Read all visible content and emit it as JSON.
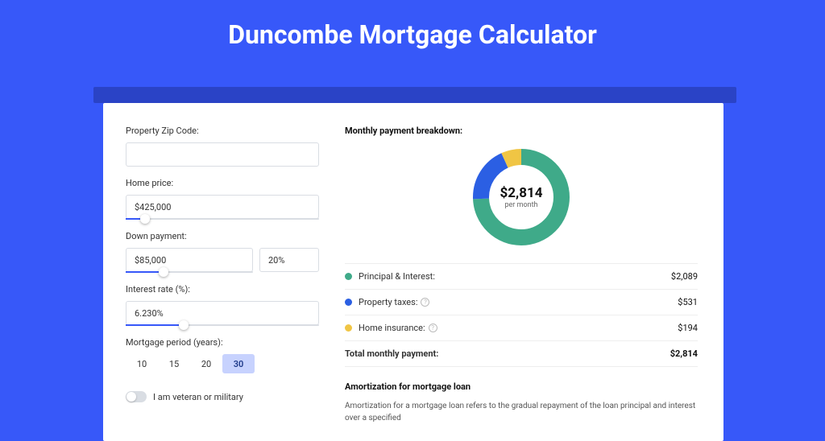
{
  "header": {
    "title": "Duncombe Mortgage Calculator"
  },
  "form": {
    "zip": {
      "label": "Property Zip Code:",
      "value": ""
    },
    "home_price": {
      "label": "Home price:",
      "value": "$425,000",
      "slider_pct": 10
    },
    "down": {
      "label": "Down payment:",
      "value": "$85,000",
      "pct": "20%",
      "slider_pct": 20
    },
    "rate": {
      "label": "Interest rate (%):",
      "value": "6.230%",
      "slider_pct": 30
    },
    "period": {
      "label": "Mortgage period (years):",
      "options": [
        "10",
        "15",
        "20",
        "30"
      ],
      "active": "30"
    },
    "veteran": {
      "label": "I am veteran or military"
    }
  },
  "breakdown": {
    "title": "Monthly payment breakdown:",
    "center_value": "$2,814",
    "center_sub": "per month",
    "items": [
      {
        "label": "Principal & Interest:",
        "value": "$2,089",
        "color": "#3faa89"
      },
      {
        "label": "Property taxes:",
        "value": "$531",
        "color": "#2b5fe3",
        "info": true
      },
      {
        "label": "Home insurance:",
        "value": "$194",
        "color": "#f0c544",
        "info": true
      }
    ],
    "total_label": "Total monthly payment:",
    "total_value": "$2,814"
  },
  "amortization": {
    "title": "Amortization for mortgage loan",
    "body": "Amortization for a mortgage loan refers to the gradual repayment of the loan principal and interest over a specified"
  },
  "chart_data": {
    "type": "pie",
    "title": "Monthly payment breakdown",
    "series": [
      {
        "name": "Principal & Interest",
        "value": 2089,
        "color": "#3faa89"
      },
      {
        "name": "Property taxes",
        "value": 531,
        "color": "#2b5fe3"
      },
      {
        "name": "Home insurance",
        "value": 194,
        "color": "#f0c544"
      }
    ],
    "total": 2814,
    "unit": "USD per month"
  }
}
